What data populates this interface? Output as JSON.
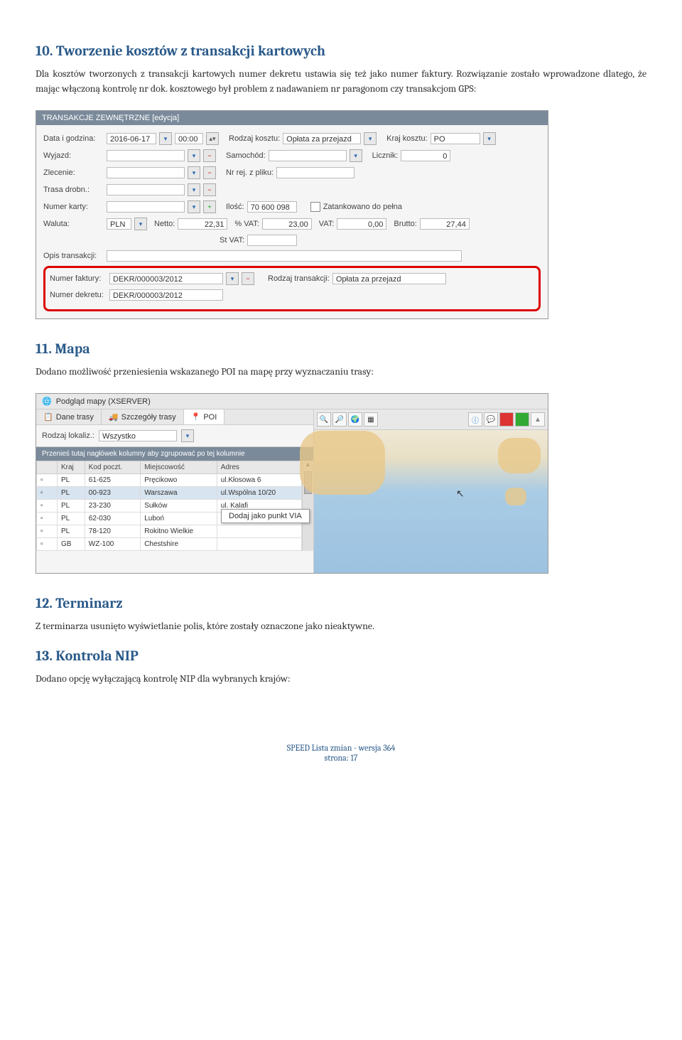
{
  "sections": {
    "s10_title": "10. Tworzenie kosztów z transakcji kartowych",
    "s10_text": "Dla kosztów tworzonych z transakcji kartowych numer dekretu ustawia się też jako numer faktury. Rozwiązanie zostało wprowadzone dlatego, że mając włączoną kontrolę nr dok. kosztowego był problem z nadawaniem nr paragonom czy transakcjom GPS:",
    "s11_title": "11. Mapa",
    "s11_text": "Dodano możliwość przeniesienia wskazanego POI na mapę przy wyznaczaniu trasy:",
    "s12_title": "12. Terminarz",
    "s12_text": "Z terminarza usunięto wyświetlanie polis, które zostały oznaczone jako nieaktywne.",
    "s13_title": "13. Kontrola NIP",
    "s13_text": "Dodano opcję wyłączającą kontrolę NIP dla wybranych krajów:"
  },
  "form": {
    "header": "TRANSAKCJE ZEWNĘTRZNE [edycja]",
    "labels": {
      "data_godzina": "Data i godzina:",
      "rodzaj_kosztu": "Rodzaj kosztu:",
      "kraj_kosztu": "Kraj kosztu:",
      "wyjazd": "Wyjazd:",
      "samochod": "Samochód:",
      "licznik": "Licznik:",
      "zlecenie": "Zlecenie:",
      "nr_rej": "Nr rej. z pliku:",
      "trasa": "Trasa drobn.:",
      "numer_karty": "Numer karty:",
      "ilosc": "Ilość:",
      "zatankowano": "Zatankowano do pełna",
      "waluta": "Waluta:",
      "netto": "Netto:",
      "pvat": "% VAT:",
      "vat": "VAT:",
      "brutto": "Brutto:",
      "stvat": "St VAT:",
      "opis": "Opis transakcji:",
      "numer_faktury": "Numer faktury:",
      "rodzaj_transakcji": "Rodzaj transakcji:",
      "numer_dekretu": "Numer dekretu:"
    },
    "values": {
      "date": "2016-06-17",
      "time": "00:00",
      "rodzaj_kosztu": "Opłata za przejazd",
      "kraj_kosztu": "PO",
      "licznik": "0",
      "ilosc": "70 600 098",
      "waluta": "PLN",
      "netto": "22,31",
      "pvat": "23,00",
      "vat": "0,00",
      "brutto": "27,44",
      "numer_faktury": "DEKR/000003/2012",
      "rodzaj_transakcji": "Opłata za przejazd",
      "numer_dekretu": "DEKR/000003/2012"
    }
  },
  "map": {
    "window_title": "Podgląd mapy (XSERVER)",
    "tabs": {
      "dane": "Dane trasy",
      "szczegoly": "Szczegóły trasy",
      "poi": "POI"
    },
    "filter_label": "Rodzaj lokaliz.:",
    "filter_value": "Wszystko",
    "group_bar": "Przenieś tutaj nagłówek kolumny aby zgrupować po tej kolumnie",
    "columns": {
      "kraj": "Kraj",
      "kod": "Kod poczt.",
      "miejsc": "Miejscowość",
      "adres": "Adres"
    },
    "rows": [
      {
        "kraj": "PL",
        "kod": "61-625",
        "miejsc": "Pręcikowo",
        "adres": "ul.Kłosowa 6"
      },
      {
        "kraj": "PL",
        "kod": "00-923",
        "miejsc": "Warszawa",
        "adres": "ul.Wspólna 10/20"
      },
      {
        "kraj": "PL",
        "kod": "23-230",
        "miejsc": "Sułków",
        "adres": "ul. Kalafi"
      },
      {
        "kraj": "PL",
        "kod": "62-030",
        "miejsc": "Luboń",
        "adres": ""
      },
      {
        "kraj": "PL",
        "kod": "78-120",
        "miejsc": "Rokitno Wielkie",
        "adres": ""
      },
      {
        "kraj": "GB",
        "kod": "WZ-100",
        "miejsc": "Chestshire",
        "adres": ""
      }
    ],
    "context_menu": "Dodaj jako punkt VIA"
  },
  "footer": {
    "line1": "SPEED Lista zmian - wersja 364",
    "line2": "strona: 17"
  }
}
